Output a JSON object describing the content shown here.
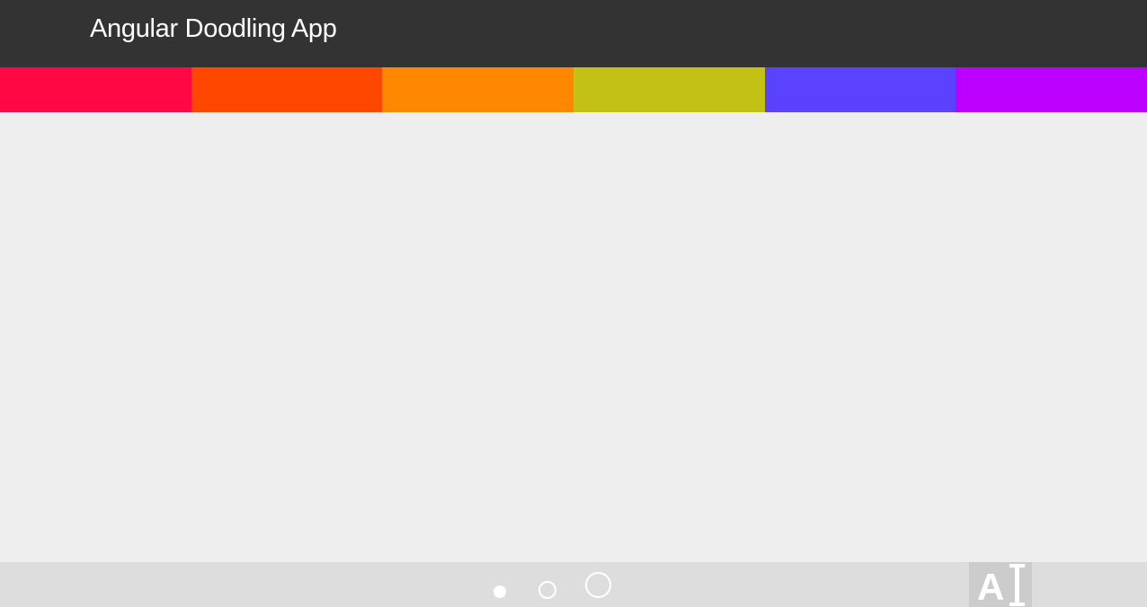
{
  "header": {
    "title": "Angular Doodling App"
  },
  "palette": {
    "colors": [
      {
        "name": "red",
        "hex": "#ff0844"
      },
      {
        "name": "orange-red",
        "hex": "#ff4700"
      },
      {
        "name": "orange",
        "hex": "#ff8800"
      },
      {
        "name": "olive",
        "hex": "#c4c116"
      },
      {
        "name": "blue-violet",
        "hex": "#5a42ff"
      },
      {
        "name": "purple",
        "hex": "#bb00ff"
      }
    ]
  },
  "toolbar": {
    "brushes": [
      {
        "size": "small",
        "icon": "filled-circle-icon"
      },
      {
        "size": "medium",
        "icon": "circle-outline-icon"
      },
      {
        "size": "large",
        "icon": "circle-outline-icon"
      }
    ],
    "text_tool": {
      "icon": "text-cursor-icon",
      "glyph": "A"
    }
  }
}
